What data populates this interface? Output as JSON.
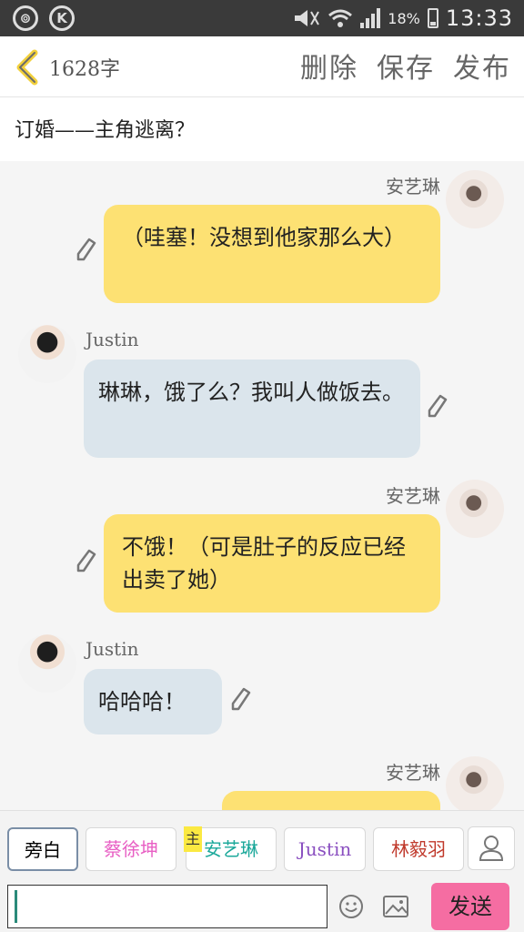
{
  "status": {
    "battery": "18%",
    "time": "13:33",
    "app_icons": [
      "weibo-icon",
      "k-icon"
    ]
  },
  "header": {
    "word_count": "1628字",
    "delete_label": "删除",
    "save_label": "保存",
    "publish_label": "发布"
  },
  "story_title": "订婚——主角逃离？",
  "messages": [
    {
      "speaker": "安艺琳",
      "side": "right",
      "text": "（哇塞！没想到他家那么大）"
    },
    {
      "speaker": "Justin",
      "side": "left",
      "text": "琳琳，饿了么？我叫人做饭去。"
    },
    {
      "speaker": "安艺琳",
      "side": "right",
      "text": "不饿！（可是肚子的反应已经出卖了她）"
    },
    {
      "speaker": "Justin",
      "side": "left",
      "text": "哈哈哈！"
    },
    {
      "speaker": "安艺琳",
      "side": "right",
      "text": ""
    }
  ],
  "roles": [
    {
      "label": "旁白",
      "color": "#333333"
    },
    {
      "label": "蔡徐坤",
      "color": "#e85fc4"
    },
    {
      "label": "安艺琳",
      "color": "#1ba89a"
    },
    {
      "label": "Justin",
      "color": "#8a4fc0"
    },
    {
      "label": "林毅羽",
      "color": "#c0392b"
    }
  ],
  "main_tag": "主",
  "compose": {
    "value": "",
    "placeholder": ""
  },
  "send_label": "发送",
  "colors": {
    "accent_yellow": "#fde173",
    "blue_bubble": "#dbe5ec",
    "send_pink": "#f56da2"
  }
}
